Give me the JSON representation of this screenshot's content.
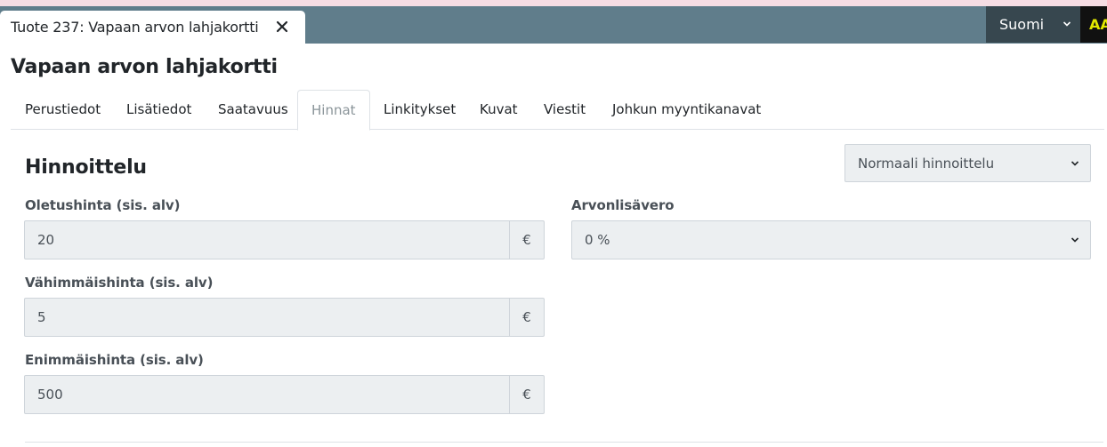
{
  "window": {
    "doc_tab_title": "Tuote 237: Vapaan arvon lahjakortti",
    "language": "Suomi",
    "aa_label": "AA"
  },
  "page": {
    "title": "Vapaan arvon lahjakortti"
  },
  "tabs": [
    {
      "label": "Perustiedot",
      "active": false
    },
    {
      "label": "Lisätiedot",
      "active": false
    },
    {
      "label": "Saatavuus",
      "active": false
    },
    {
      "label": "Hinnat",
      "active": true
    },
    {
      "label": "Linkitykset",
      "active": false
    },
    {
      "label": "Kuvat",
      "active": false
    },
    {
      "label": "Viestit",
      "active": false
    },
    {
      "label": "Johkun myyntikanavat",
      "active": false
    }
  ],
  "pricing": {
    "title": "Hinnoittelu",
    "mode_select": "Normaali hinnoittelu",
    "default_price_label": "Oletushinta (sis. alv)",
    "default_price_value": "20",
    "min_price_label": "Vähimmäishinta (sis. alv)",
    "min_price_value": "5",
    "max_price_label": "Enimmäishinta (sis. alv)",
    "max_price_value": "500",
    "currency": "€",
    "vat_label": "Arvonlisävero",
    "vat_value": "0 %"
  },
  "colors": {
    "topbar": "#607d8b",
    "language_bg": "#37474f",
    "input_bg": "#eceff1",
    "accent_yellow": "#e2e800"
  }
}
